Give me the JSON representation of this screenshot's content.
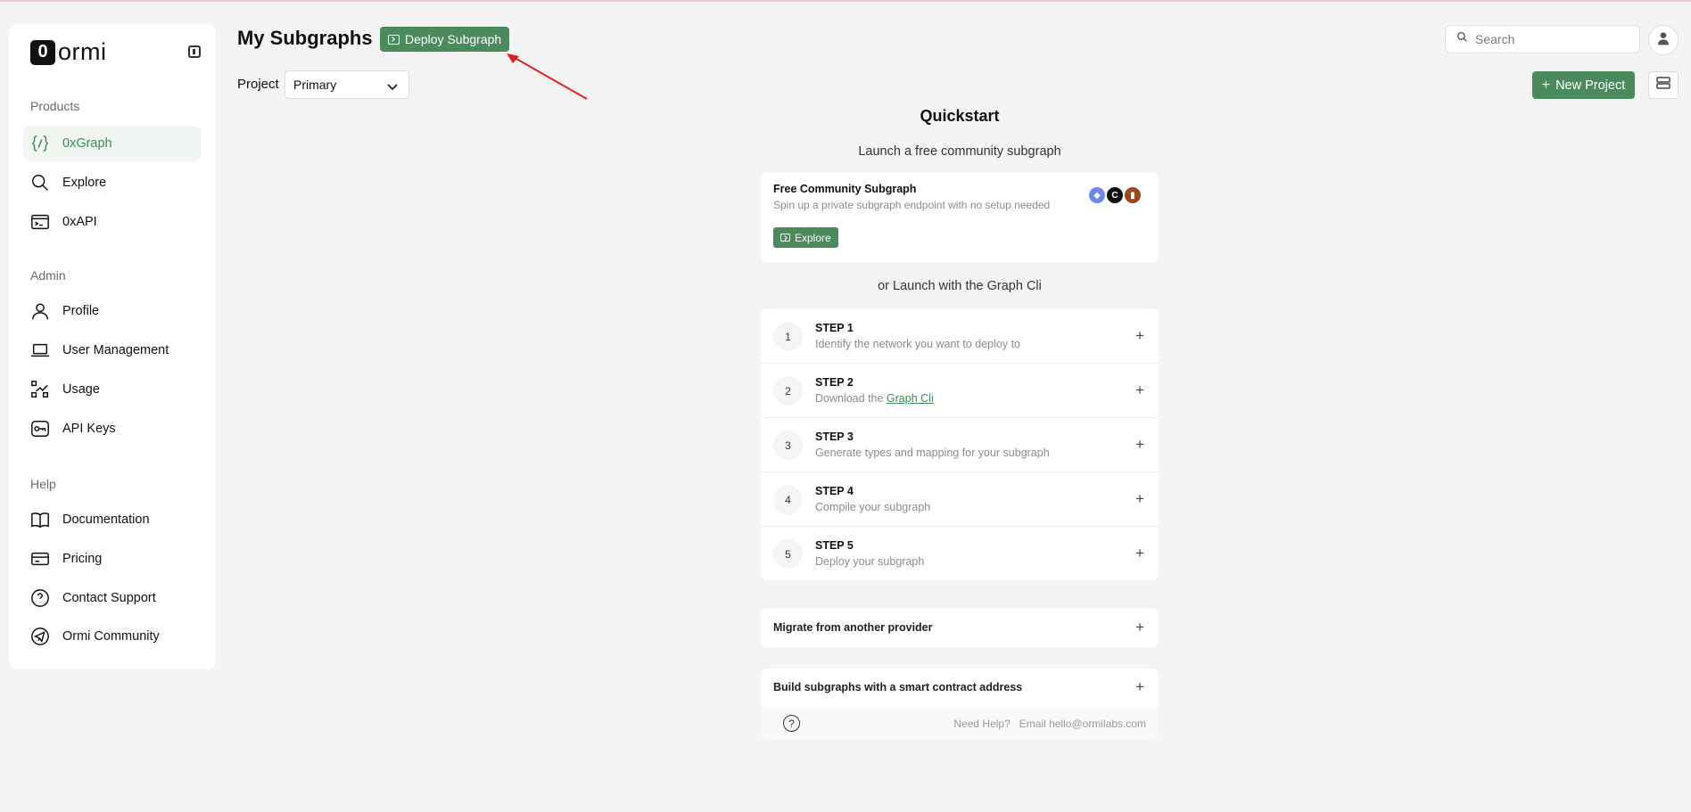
{
  "app": {
    "logo_letter": "0",
    "logo_text": "ormi"
  },
  "sidebar": {
    "sections": {
      "products": "Products",
      "admin": "Admin",
      "help": "Help"
    },
    "items": [
      {
        "label": "0xGraph",
        "icon": "code-braces-icon"
      },
      {
        "label": "Explore",
        "icon": "search-icon"
      },
      {
        "label": "0xAPI",
        "icon": "terminal-icon"
      },
      {
        "label": "Profile",
        "icon": "user-icon"
      },
      {
        "label": "User Management",
        "icon": "laptop-icon"
      },
      {
        "label": "Usage",
        "icon": "chart-icon"
      },
      {
        "label": "API Keys",
        "icon": "key-icon"
      },
      {
        "label": "Documentation",
        "icon": "book-icon"
      },
      {
        "label": "Pricing",
        "icon": "credit-card-icon"
      },
      {
        "label": "Contact Support",
        "icon": "help-circle-icon"
      },
      {
        "label": "Ormi Community",
        "icon": "telegram-icon"
      }
    ]
  },
  "header": {
    "title": "My Subgraphs",
    "deploy_label": "Deploy Subgraph",
    "search_placeholder": "Search",
    "project_label": "Project",
    "project_value": "Primary",
    "new_project_label": "New Project"
  },
  "quickstart": {
    "title": "Quickstart",
    "subtitle": "Launch a free community subgraph",
    "community_card": {
      "title": "Free Community Subgraph",
      "description": "Spin up a private subgraph endpoint with no setup needed",
      "explore_label": "Explore"
    },
    "or_launch": "or Launch with the Graph Cli",
    "steps": [
      {
        "num": "1",
        "title": "STEP 1",
        "desc": "Identify the network you want to deploy to"
      },
      {
        "num": "2",
        "title": "STEP 2",
        "desc_prefix": "Download the ",
        "link": "Graph Cli"
      },
      {
        "num": "3",
        "title": "STEP 3",
        "desc": "Generate types and mapping for your subgraph"
      },
      {
        "num": "4",
        "title": "STEP 4",
        "desc": "Compile your subgraph"
      },
      {
        "num": "5",
        "title": "STEP 5",
        "desc": "Deploy your subgraph"
      }
    ],
    "migrate_label": "Migrate from another provider",
    "build_label": "Build subgraphs with a smart contract address",
    "help_label": "Need Help?",
    "help_email": "Email hello@ormilabs.com"
  },
  "colors": {
    "accent": "#4b8a5c",
    "accent_text": "#3e8b55",
    "annotation_arrow": "#e02020"
  }
}
